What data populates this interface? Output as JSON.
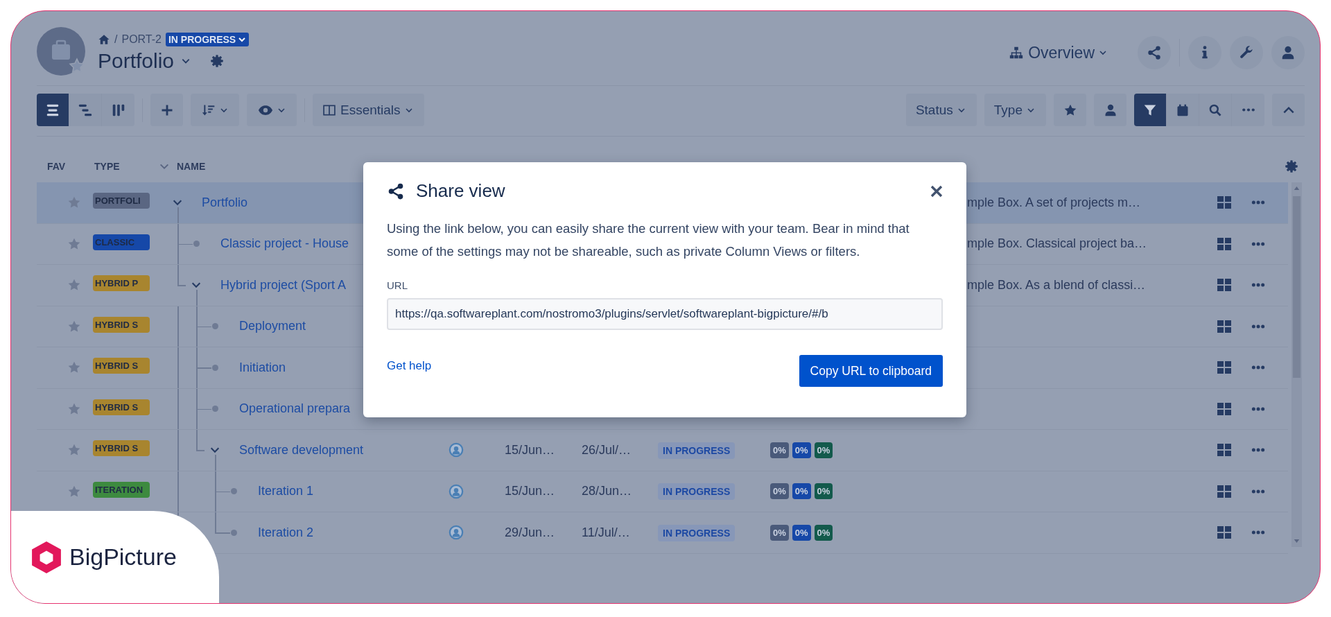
{
  "breadcrumb": {
    "separator": "/",
    "key": "PORT-2",
    "status": "IN PROGRESS"
  },
  "title": "Portfolio",
  "header": {
    "view_switch": "Overview"
  },
  "view_modes": [
    {
      "kind": "list",
      "selected": true
    },
    {
      "kind": "tree",
      "selected": false
    },
    {
      "kind": "board",
      "selected": false
    }
  ],
  "column_view": "Essentials",
  "filters": [
    {
      "label": "Status"
    },
    {
      "label": "Type"
    }
  ],
  "quick_filters": [
    {
      "kind": "favorites",
      "on": false
    },
    {
      "kind": "mine",
      "on": false
    }
  ],
  "view_tools": [
    {
      "kind": "filter",
      "on": true
    },
    {
      "kind": "calendar",
      "on": false
    },
    {
      "kind": "search",
      "on": false
    },
    {
      "kind": "more",
      "on": false
    }
  ],
  "table": {
    "columns": [
      "FAV",
      "TYPE",
      "NAME"
    ],
    "rows": [
      {
        "type": "PORTFOLI",
        "color": "#5a6682",
        "name": "Portfolio",
        "selected": true,
        "expanded": true,
        "description": "mple Box. A set of projects m…",
        "children": [
          {
            "type": "CLASSIC",
            "color": "#1648a8",
            "name": "Classic project - House",
            "selected": false,
            "description": "mple Box. Classical project ba…"
          },
          {
            "type": "HYBRID P",
            "color": "#a8852f",
            "name": "Hybrid project (Sport A",
            "selected": false,
            "expanded": true,
            "description": "mple Box. As a blend of classi…",
            "children": [
              {
                "type": "HYBRID S",
                "color": "#a8852f",
                "name": "Deployment",
                "selected": false
              },
              {
                "type": "HYBRID S",
                "color": "#a8852f",
                "name": "Initiation",
                "selected": false
              },
              {
                "type": "HYBRID S",
                "color": "#a8852f",
                "name": "Operational prepara",
                "selected": false
              },
              {
                "type": "HYBRID S",
                "color": "#a8852f",
                "name": "Software development",
                "selected": false,
                "expanded": true,
                "start": "15/Jun…",
                "end": "26/Jul/…",
                "status": "IN PROGRESS",
                "progress": [
                  {
                    "value": "0%",
                    "color": "#4a5a7a"
                  },
                  {
                    "value": "0%",
                    "color": "#1648a8"
                  },
                  {
                    "value": "0%",
                    "color": "#135a4c"
                  }
                ],
                "children": [
                  {
                    "type": "ITERATION",
                    "color": "#3d8a3f",
                    "name": "Iteration 1",
                    "selected": false,
                    "start": "15/Jun…",
                    "end": "28/Jun…",
                    "status": "IN PROGRESS",
                    "progress": [
                      {
                        "value": "0%",
                        "color": "#4a5a7a"
                      },
                      {
                        "value": "0%",
                        "color": "#1648a8"
                      },
                      {
                        "value": "0%",
                        "color": "#135a4c"
                      }
                    ]
                  },
                  {
                    "name": "Iteration 2",
                    "selected": false,
                    "start": "29/Jun…",
                    "end": "11/Jul/…",
                    "status": "IN PROGRESS",
                    "progress": [
                      {
                        "value": "0%",
                        "color": "#4a5a7a"
                      },
                      {
                        "value": "0%",
                        "color": "#1648a8"
                      },
                      {
                        "value": "0%",
                        "color": "#135a4c"
                      }
                    ]
                  }
                ]
              }
            ]
          }
        ]
      }
    ]
  },
  "dialog": {
    "title": "Share view",
    "text": "Using the link below, you can easily share the current view with your team. Bear in mind that some of the settings may not be shareable, such as private Column Views or filters.",
    "url_label": "URL",
    "url": "https://qa.softwareplant.com/nostromo3/plugins/servlet/softwareplant-bigpicture/#/b",
    "help_link": "Get help",
    "copy_button": "Copy URL to clipboard"
  },
  "brand": {
    "name": "BigPicture"
  }
}
